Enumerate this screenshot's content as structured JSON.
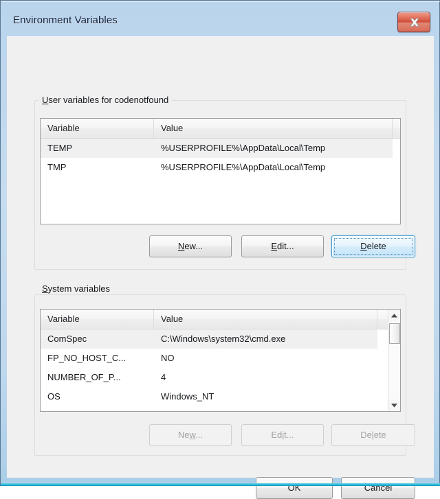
{
  "window": {
    "title": "Environment Variables",
    "close_icon": "close-x-icon",
    "accent_close": "#cf4a35",
    "accent_focus": "#3c9dd4",
    "frame_color": "#bfd8ee",
    "client_bg": "#f0f0f0"
  },
  "user_group": {
    "label_prefix": "U",
    "label_rest": "ser variables for codenotfound",
    "columns": [
      "Variable",
      "Value",
      ""
    ],
    "rows": [
      {
        "variable": "TEMP",
        "value": "%USERPROFILE%\\AppData\\Local\\Temp",
        "selected": true
      },
      {
        "variable": "TMP",
        "value": "%USERPROFILE%\\AppData\\Local\\Temp",
        "selected": false
      }
    ],
    "buttons": {
      "new": {
        "pre": "N",
        "accel": "",
        "post": "ew...",
        "label": "New...",
        "enabled": true,
        "focused": false
      },
      "edit": {
        "pre": "",
        "accel": "E",
        "post": "dit...",
        "label": "Edit...",
        "enabled": true,
        "focused": false
      },
      "delete": {
        "pre": "",
        "accel": "D",
        "post": "elete",
        "label": "Delete",
        "enabled": true,
        "focused": true
      }
    }
  },
  "system_group": {
    "label_prefix": "S",
    "label_rest": "ystem variables",
    "columns": [
      "Variable",
      "Value"
    ],
    "rows": [
      {
        "variable": "ComSpec",
        "value": "C:\\Windows\\system32\\cmd.exe",
        "selected": true
      },
      {
        "variable": "FP_NO_HOST_C...",
        "value": "NO",
        "selected": false
      },
      {
        "variable": "NUMBER_OF_P...",
        "value": "4",
        "selected": false
      },
      {
        "variable": "OS",
        "value": "Windows_NT",
        "selected": false
      }
    ],
    "scrollbar": {
      "up_icon": "scroll-up-arrow-icon",
      "down_icon": "scroll-down-arrow-icon",
      "thumb_position_percent": 3
    },
    "buttons": {
      "new": {
        "label": "New...",
        "enabled": false
      },
      "edit": {
        "label": "Edit...",
        "enabled": false
      },
      "delete": {
        "label": "Delete",
        "enabled": false
      }
    }
  },
  "dialog_buttons": {
    "ok": "OK",
    "cancel": "Cancel"
  }
}
